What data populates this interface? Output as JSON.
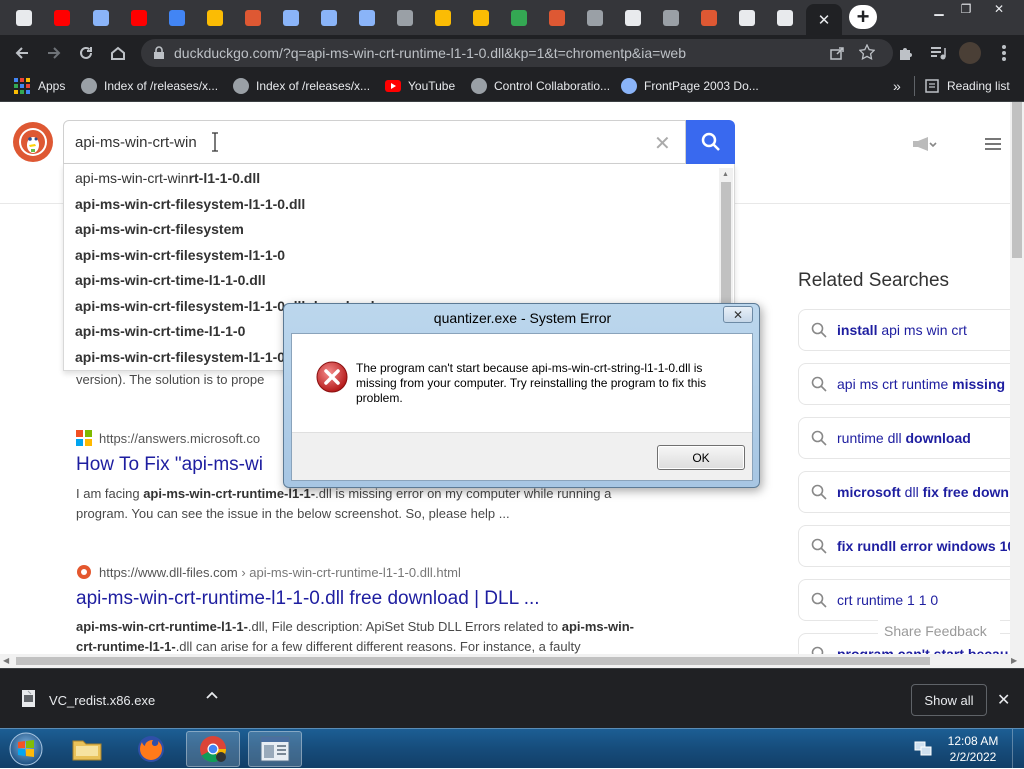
{
  "browser": {
    "url": "duckduckgo.com/?q=api-ms-win-crt-runtime-l1-1-0.dll&kp=1&t=chromentp&ia=web",
    "new_tab_symbol": "+",
    "tab_favicons": [
      {
        "icon": "settings-box-icon",
        "color": "#e8eaed"
      },
      {
        "icon": "youtube-icon",
        "color": "#ff0000"
      },
      {
        "icon": "upload-icon",
        "color": "#8ab4f8"
      },
      {
        "icon": "youtube-icon",
        "color": "#ff0000"
      },
      {
        "icon": "chart-icon",
        "color": "#4285f4"
      },
      {
        "icon": "drive-icon",
        "color": "#fbbc04"
      },
      {
        "icon": "duckduckgo-icon",
        "color": "#de5833"
      },
      {
        "icon": "play-icon",
        "color": "#8ab4f8"
      },
      {
        "icon": "play-icon",
        "color": "#8ab4f8"
      },
      {
        "icon": "play-icon",
        "color": "#8ab4f8"
      },
      {
        "icon": "globe-icon",
        "color": "#9aa0a6"
      },
      {
        "icon": "image-icon",
        "color": "#fbbc04"
      },
      {
        "icon": "image-icon",
        "color": "#fbbc04"
      },
      {
        "icon": "chart-icon",
        "color": "#34a853"
      },
      {
        "icon": "duckduckgo-icon",
        "color": "#de5833"
      },
      {
        "icon": "gear-icon",
        "color": "#9aa0a6"
      },
      {
        "icon": "github-icon",
        "color": "#e8eaed"
      },
      {
        "icon": "download-icon",
        "color": "#9aa0a6"
      },
      {
        "icon": "duckduckgo-icon",
        "color": "#de5833"
      },
      {
        "icon": "settings-box-icon",
        "color": "#e8eaed"
      },
      {
        "icon": "piano-icon",
        "color": "#e8eaed"
      },
      {
        "icon": "settings-box-icon",
        "color": "#e8eaed"
      }
    ],
    "bookmarks": [
      {
        "label": "Apps",
        "icon": "apps-grid-icon"
      },
      {
        "label": "Index of /releases/x...",
        "icon": "globe-icon"
      },
      {
        "label": "Index of /releases/x...",
        "icon": "globe-icon"
      },
      {
        "label": "YouTube",
        "icon": "youtube-icon"
      },
      {
        "label": "Control Collaboratio...",
        "icon": "globe-icon"
      },
      {
        "label": "FrontPage 2003 Do...",
        "icon": "globe-icon"
      }
    ],
    "reading_list": "Reading list",
    "more_bookmarks": "»"
  },
  "search": {
    "query": "api-ms-win-crt-win",
    "suggestions": [
      {
        "typed": "api-ms-win-crt-win",
        "rest": "rt-l1-1-0.dll"
      },
      {
        "typed": "",
        "rest": "api-ms-win-crt-filesystem-l1-1-0.dll"
      },
      {
        "typed": "",
        "rest": "api-ms-win-crt-filesystem"
      },
      {
        "typed": "",
        "rest": "api-ms-win-crt-filesystem-l1-1-0"
      },
      {
        "typed": "",
        "rest": "api-ms-win-crt-time-l1-1-0.dll"
      },
      {
        "typed": "",
        "rest": "api-ms-win-crt-filesystem-l1-1-0.dll download"
      },
      {
        "typed": "",
        "rest": "api-ms-win-crt-time-l1-1-0"
      },
      {
        "typed": "",
        "rest": "api-ms-win-crt-filesystem-l1-1-0 dll"
      }
    ]
  },
  "results": {
    "partial_line": "version). The solution is to prope",
    "r1_url": "https://answers.microsoft.co",
    "r1_title": "How To Fix \"api-ms-wi",
    "r1_snippet_1a": "I am facing ",
    "r1_snippet_1b": "api-ms-win-crt-runtime-l1-1-",
    "r1_snippet_1c": ".dll is missing error on my computer while running a",
    "r1_snippet_2": "program. You can see the issue in the below screenshot. So, please help ...",
    "r2_url": "https://www.dll-files.com",
    "r2_path": " › api-ms-win-crt-runtime-l1-1-0.dll.html",
    "r2_title": "api-ms-win-crt-runtime-l1-1-0.dll free download | DLL ...",
    "r2_snippet_1a": "api-ms-win-crt-runtime-l1-1-",
    "r2_snippet_1b": ".dll, File description: ApiSet Stub DLL Errors related to ",
    "r2_snippet_1c": "api-ms-win-",
    "r2_snippet_2a": "crt-runtime-l1-1-",
    "r2_snippet_2b": ".dll can arise for a few different different reasons. For instance, a faulty"
  },
  "related": {
    "title": "Related Searches",
    "items": [
      {
        "bold": "install",
        "normal": " api ms win crt"
      },
      {
        "bold": "",
        "normal": "api ms crt runtime ",
        "bold2": "missing"
      },
      {
        "bold": "",
        "normal": "runtime dll ",
        "bold2": "download"
      },
      {
        "bold": "microsoft",
        "normal": " dll ",
        "bold2": "fix free down"
      },
      {
        "bold": "fix rundll error windows 10",
        "normal": ""
      },
      {
        "bold": "",
        "normal": "crt runtime 1 1 0"
      },
      {
        "bold": "program can't start becau",
        "normal": ""
      }
    ],
    "feedback": "Share Feedback"
  },
  "dialog": {
    "title": "quantizer.exe - System Error",
    "message": "The program can't start because api-ms-win-crt-string-l1-1-0.dll is missing from your computer. Try reinstalling the program to fix this problem.",
    "ok": "OK",
    "close": "✕"
  },
  "downloads": {
    "file": "VC_redist.x86.exe",
    "show_all": "Show all"
  },
  "taskbar": {
    "time": "12:08 AM",
    "date": "2/2/2022"
  },
  "colors": {
    "ddg_orange": "#de5833",
    "search_blue": "#3969ef",
    "link_blue": "#1e1ea0"
  }
}
